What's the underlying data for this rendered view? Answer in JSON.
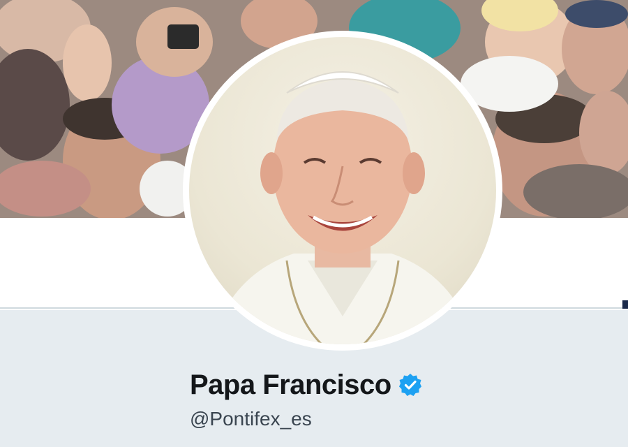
{
  "profile": {
    "display_name": "Papa Francisco",
    "handle": "@Pontifex_es",
    "verified": true
  },
  "icons": {
    "verified": "verified-badge-icon"
  },
  "colors": {
    "verified_blue": "#1da1f2",
    "profile_bg": "#e6ecf0",
    "name_text": "#14171a",
    "handle_text": "#3a4550"
  }
}
